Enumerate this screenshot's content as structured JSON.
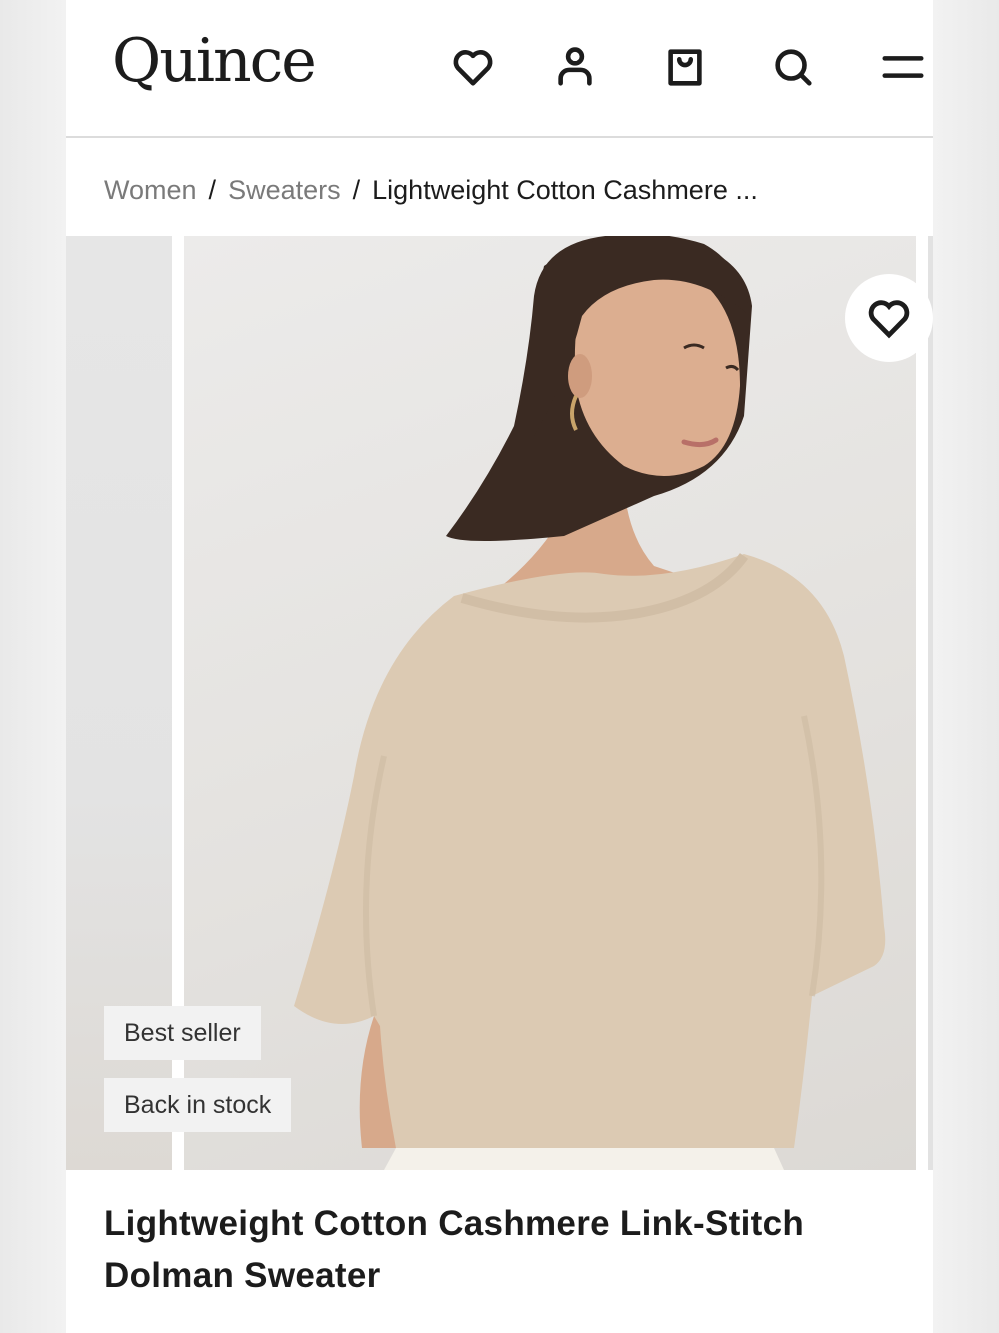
{
  "header": {
    "logo": "Quince",
    "icons": [
      "heart-icon",
      "user-icon",
      "bag-icon",
      "search-icon",
      "menu-icon"
    ]
  },
  "breadcrumb": {
    "items": [
      "Women",
      "Sweaters"
    ],
    "separator": "/",
    "current": "Lightweight Cotton Cashmere ..."
  },
  "gallery": {
    "badges": [
      "Best seller",
      "Back in stock"
    ]
  },
  "product": {
    "title": "Lightweight Cotton Cashmere Link-Stitch Dolman Sweater"
  },
  "colors": {
    "sweater": "#dccab3",
    "hair": "#3a2a22",
    "skin": "#d9ab8e",
    "background": "#e6e4e1"
  }
}
